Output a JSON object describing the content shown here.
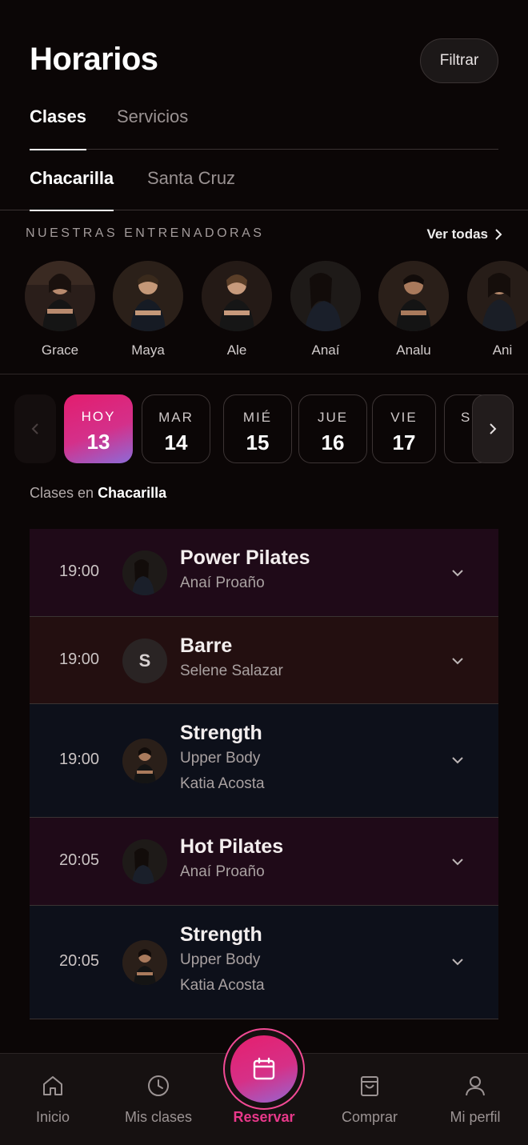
{
  "header": {
    "title": "Horarios",
    "filter_label": "Filtrar"
  },
  "tabs": [
    {
      "label": "Clases",
      "active": true
    },
    {
      "label": "Servicios",
      "active": false
    }
  ],
  "locations": [
    {
      "label": "Chacarilla",
      "active": true
    },
    {
      "label": "Santa Cruz",
      "active": false
    }
  ],
  "trainers_section": {
    "title": "NUESTRAS ENTRENADORAS",
    "see_all": "Ver todas",
    "trainers": [
      "Grace",
      "Maya",
      "Ale",
      "Anaí",
      "Analu",
      "Ani"
    ]
  },
  "dates": [
    {
      "dow": "HOY",
      "day": "13",
      "selected": true
    },
    {
      "dow": "MAR",
      "day": "14"
    },
    {
      "dow": "MIÉ",
      "day": "15"
    },
    {
      "dow": "JUE",
      "day": "16"
    },
    {
      "dow": "VIE",
      "day": "17"
    },
    {
      "dow": "S",
      "day": ""
    }
  ],
  "classes_in": {
    "prefix": "Clases en",
    "location": "Chacarilla"
  },
  "classes": [
    {
      "time": "19:00",
      "name": "Power Pilates",
      "subtitle": "",
      "instructor": "Anaí Proaño",
      "bg": "#1f0a18",
      "avatar": "photo"
    },
    {
      "time": "19:00",
      "name": "Barre",
      "subtitle": "",
      "instructor": "Selene Salazar",
      "avatar_letter": "S",
      "bg": "#230f10",
      "avatar": "letter"
    },
    {
      "time": "19:00",
      "name": "Strength",
      "subtitle": "Upper Body",
      "instructor": "Katia Acosta",
      "bg": "#0d101a",
      "avatar": "photo"
    },
    {
      "time": "20:05",
      "name": "Hot Pilates",
      "subtitle": "",
      "instructor": "Anaí Proaño",
      "bg": "#1f0a18",
      "avatar": "photo"
    },
    {
      "time": "20:05",
      "name": "Strength",
      "subtitle": "Upper Body",
      "instructor": "Katia Acosta",
      "bg": "#0d101a",
      "avatar": "photo"
    }
  ],
  "bottom_nav": {
    "items": [
      {
        "label": "Inicio",
        "icon": "home-icon"
      },
      {
        "label": "Mis clases",
        "icon": "clock-icon"
      },
      {
        "label": "Reservar",
        "icon": "calendar-icon",
        "active": true
      },
      {
        "label": "Comprar",
        "icon": "shopping-bag-icon"
      },
      {
        "label": "Mi perfil",
        "icon": "user-icon"
      }
    ]
  },
  "colors": {
    "accent": "#e8388a",
    "gradient_start": "#e31d6e",
    "gradient_end": "#8c6bd8",
    "background": "#0b0606"
  }
}
